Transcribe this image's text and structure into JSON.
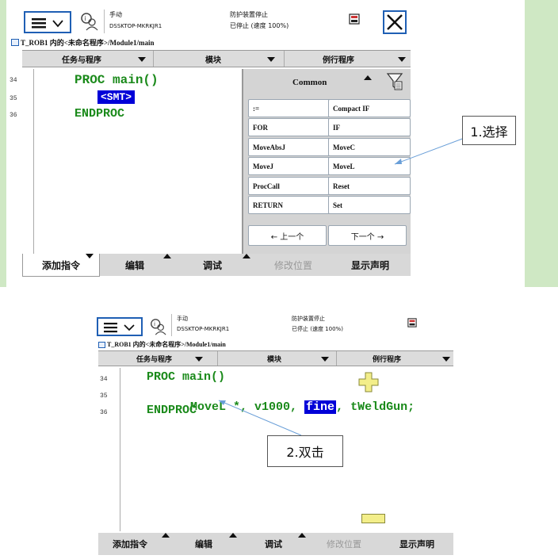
{
  "screen1": {
    "header": {
      "mode": "手动",
      "controller": "DSSKTOP-MKRKJR1",
      "status_line1": "防护装置停止",
      "status_line2": "已停止 (速度 100%)"
    },
    "breadcrumb": "T_ROB1 内的<未命名程序>/Module1/main",
    "dropdowns": {
      "tasks": "任务与程序",
      "modules": "模块",
      "routines": "例行程序"
    },
    "line_numbers": [
      "34",
      "35",
      "36"
    ],
    "code": {
      "line34": "PROC main()",
      "line35": "<SMT>",
      "line36": "ENDPROC"
    },
    "panel": {
      "title": "Common",
      "buttons": [
        ":=",
        "Compact IF",
        "FOR",
        "IF",
        "MoveAbsJ",
        "MoveC",
        "MoveJ",
        "MoveL",
        "ProcCall",
        "Reset",
        "RETURN",
        "Set"
      ],
      "prev": "←  上一个",
      "next": "下一个  →"
    },
    "bottom_tabs": [
      "添加指令",
      "编辑",
      "调试",
      "修改位置",
      "显示声明"
    ],
    "callout": "1.选择"
  },
  "screen2": {
    "header": {
      "mode": "手动",
      "controller": "DSSKTOP-MKRKJR1",
      "status_line1": "防护装置停止",
      "status_line2": "已停止 (速度 100%)"
    },
    "breadcrumb": "T_ROB1 内的<未命名程序>/Module1/main",
    "dropdowns": {
      "tasks": "任务与程序",
      "modules": "模块",
      "routines": "例行程序"
    },
    "line_numbers": [
      "34",
      "35",
      "36"
    ],
    "code": {
      "line34": "PROC main()",
      "line35_pre": "MoveL *, v1000, ",
      "line35_sel": "fine",
      "line35_post": ", tWeldGun;",
      "line36": "ENDPROC"
    },
    "bottom_tabs": [
      "添加指令",
      "编辑",
      "调试",
      "修改位置",
      "显示声明"
    ],
    "callout": "2.双击"
  },
  "colors": {
    "accent_blue": "#1f5fb4",
    "code_green": "#1a8a1a",
    "selection": "#0000d8",
    "side_green": "#cfe8c4",
    "zoom_yellow": "#f3ee8a"
  }
}
